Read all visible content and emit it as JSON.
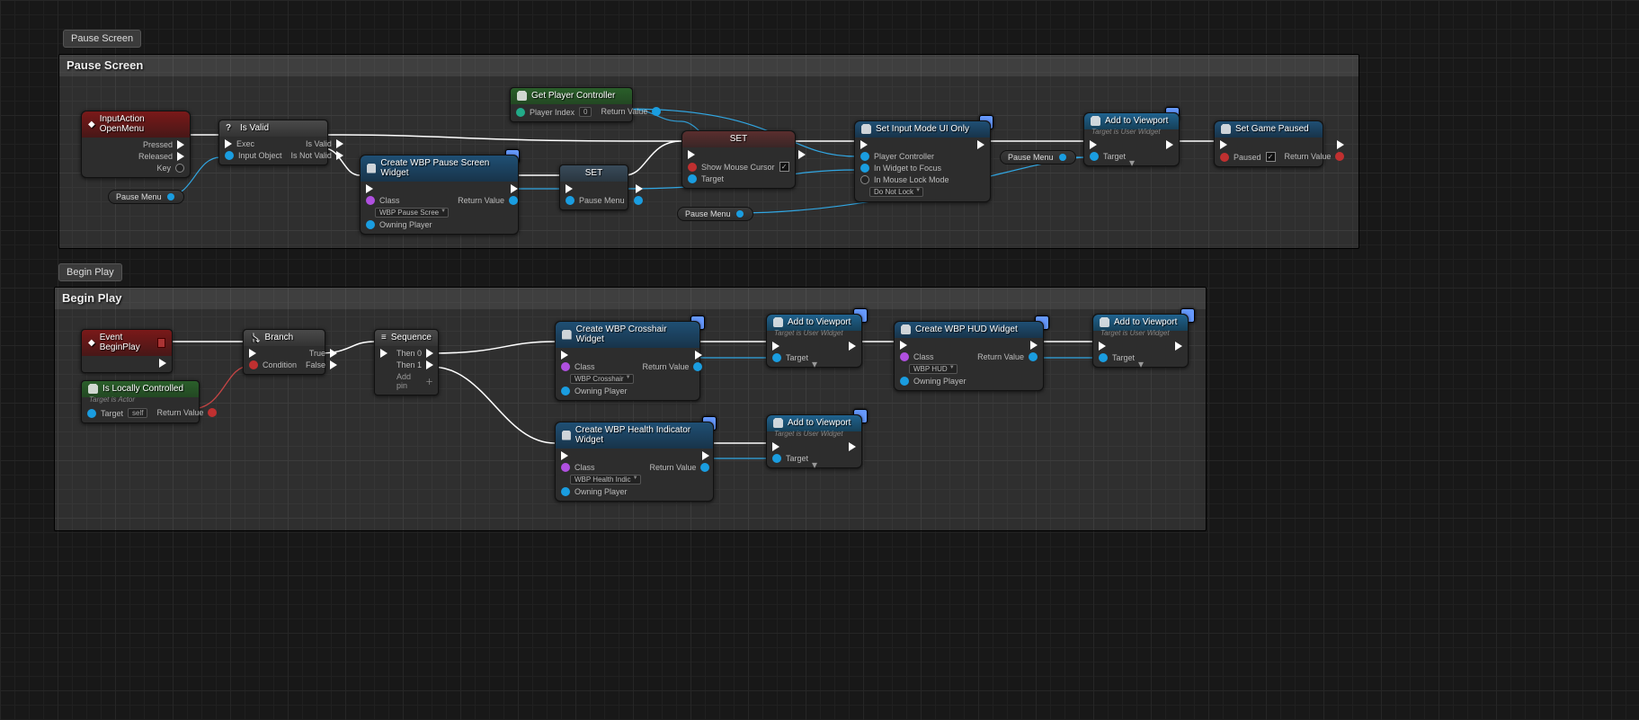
{
  "tags": {
    "pause": "Pause Screen",
    "begin": "Begin Play"
  },
  "comments": {
    "pause": "Pause Screen",
    "begin": "Begin Play"
  },
  "pins": {
    "pressed": "Pressed",
    "released": "Released",
    "key": "Key",
    "exec": "Exec",
    "isvalid": "Is Valid",
    "isnotvalid": "Is Not Valid",
    "inputobj": "Input Object",
    "class": "Class",
    "owning": "Owning Player",
    "retval": "Return Value",
    "pidx": "Player Index",
    "pidxv": "0",
    "showcursor": "Show Mouse Cursor",
    "target": "Target",
    "pcontroller": "Player Controller",
    "widgetfocus": "In Widget to Focus",
    "mlock": "In Mouse Lock Mode",
    "mlockv": "Do Not Lock",
    "paused": "Paused",
    "cond": "Condition",
    "true": "True",
    "false": "False",
    "then0": "Then 0",
    "then1": "Then 1",
    "addpin": "Add pin",
    "tself": "self",
    "tgtsub": "Target is User Widget",
    "tgtactor": "Target is Actor",
    "varpm": "Pause Menu"
  },
  "cls": {
    "pausescr": "WBP Pause Scree",
    "cross": "WBP Crosshair",
    "hud": "WBP HUD",
    "health": "WBP Health Indic"
  },
  "nodes": {
    "input": "InputAction OpenMenu",
    "isvalid": "Is Valid",
    "cwPause": "Create WBP Pause Screen Widget",
    "setPM": "SET",
    "pmvar": "Pause Menu",
    "getpc": "Get Player Controller",
    "setSMC": "SET",
    "setui": "Set Input Mode UI Only",
    "addvp": "Add to Viewport",
    "setpaused": "Set Game Paused",
    "beginplay": "Event BeginPlay",
    "islocal": "Is Locally Controlled",
    "branch": "Branch",
    "seq": "Sequence",
    "cwCross": "Create WBP Crosshair Widget",
    "cwHud": "Create WBP HUD Widget",
    "cwHealth": "Create WBP Health Indicator Widget"
  }
}
